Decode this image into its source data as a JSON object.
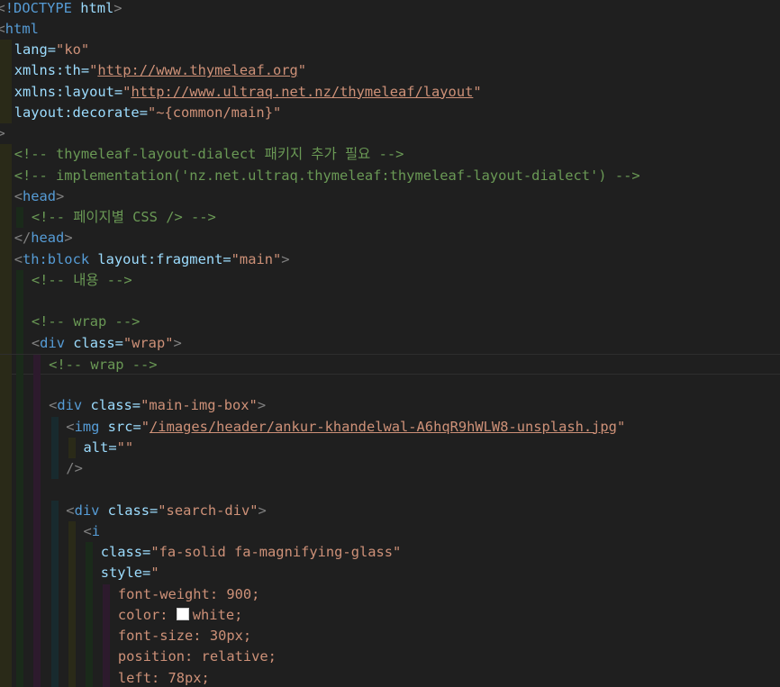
{
  "editor": {
    "language": "html",
    "active_line": 17,
    "lines": [
      {
        "indent": 0,
        "tokens": [
          [
            "b",
            "<"
          ],
          [
            "t",
            "!DOCTYPE"
          ],
          [
            "a",
            " html"
          ],
          [
            "b",
            ">"
          ]
        ]
      },
      {
        "indent": 0,
        "tokens": [
          [
            "b",
            "<"
          ],
          [
            "t",
            "html"
          ]
        ]
      },
      {
        "indent": 1,
        "tokens": [
          [
            "a",
            "lang"
          ],
          [
            "a",
            "="
          ],
          [
            "s",
            "\"ko\""
          ]
        ]
      },
      {
        "indent": 1,
        "tokens": [
          [
            "a",
            "xmlns:th"
          ],
          [
            "a",
            "="
          ],
          [
            "s",
            "\""
          ],
          [
            "l",
            "http://www.thymeleaf.org"
          ],
          [
            "s",
            "\""
          ]
        ]
      },
      {
        "indent": 1,
        "tokens": [
          [
            "a",
            "xmlns:layout"
          ],
          [
            "a",
            "="
          ],
          [
            "s",
            "\""
          ],
          [
            "l",
            "http://www.ultraq.net.nz/thymeleaf/layout"
          ],
          [
            "s",
            "\""
          ]
        ]
      },
      {
        "indent": 1,
        "tokens": [
          [
            "a",
            "layout:decorate"
          ],
          [
            "a",
            "="
          ],
          [
            "s",
            "\"~{common/main}\""
          ]
        ]
      },
      {
        "indent": 0,
        "tokens": [
          [
            "b",
            ">"
          ]
        ]
      },
      {
        "indent": 1,
        "tokens": [
          [
            "c",
            "<!-- thymeleaf-layout-dialect 패키지 추가 필요 -->"
          ]
        ]
      },
      {
        "indent": 1,
        "tokens": [
          [
            "c",
            "<!-- implementation('nz.net.ultraq.thymeleaf:thymeleaf-layout-dialect') -->"
          ]
        ]
      },
      {
        "indent": 1,
        "tokens": [
          [
            "b",
            "<"
          ],
          [
            "t",
            "head"
          ],
          [
            "b",
            ">"
          ]
        ]
      },
      {
        "indent": 2,
        "tokens": [
          [
            "c",
            "<!-- 페이지별 CSS /> -->"
          ]
        ]
      },
      {
        "indent": 1,
        "tokens": [
          [
            "b",
            "</"
          ],
          [
            "t",
            "head"
          ],
          [
            "b",
            ">"
          ]
        ]
      },
      {
        "indent": 1,
        "tokens": [
          [
            "b",
            "<"
          ],
          [
            "t",
            "th:block"
          ],
          [
            "a",
            " layout:fragment"
          ],
          [
            "a",
            "="
          ],
          [
            "s",
            "\"main\""
          ],
          [
            "b",
            ">"
          ]
        ]
      },
      {
        "indent": 2,
        "tokens": [
          [
            "c",
            "<!-- 내용 -->"
          ]
        ]
      },
      {
        "indent": 2,
        "tokens": []
      },
      {
        "indent": 2,
        "tokens": [
          [
            "c",
            "<!-- wrap -->"
          ]
        ]
      },
      {
        "indent": 2,
        "tokens": [
          [
            "b",
            "<"
          ],
          [
            "t",
            "div"
          ],
          [
            "a",
            " class"
          ],
          [
            "a",
            "="
          ],
          [
            "s",
            "\"wrap\""
          ],
          [
            "b",
            ">"
          ]
        ]
      },
      {
        "indent": 3,
        "tokens": [
          [
            "c",
            "<!-- wrap -->"
          ]
        ]
      },
      {
        "indent": 3,
        "tokens": []
      },
      {
        "indent": 3,
        "tokens": [
          [
            "b",
            "<"
          ],
          [
            "t",
            "div"
          ],
          [
            "a",
            " class"
          ],
          [
            "a",
            "="
          ],
          [
            "s",
            "\"main-img-box\""
          ],
          [
            "b",
            ">"
          ]
        ]
      },
      {
        "indent": 4,
        "tokens": [
          [
            "b",
            "<"
          ],
          [
            "t",
            "img"
          ],
          [
            "a",
            " src"
          ],
          [
            "a",
            "="
          ],
          [
            "s",
            "\""
          ],
          [
            "l",
            "/images/header/ankur-khandelwal-A6hqR9hWLW8-unsplash.jpg"
          ],
          [
            "s",
            "\""
          ]
        ]
      },
      {
        "indent": 5,
        "tokens": [
          [
            "a",
            "alt"
          ],
          [
            "a",
            "="
          ],
          [
            "s",
            "\"\""
          ]
        ]
      },
      {
        "indent": 4,
        "tokens": [
          [
            "b",
            "/>"
          ]
        ]
      },
      {
        "indent": 3,
        "tokens": []
      },
      {
        "indent": 4,
        "tokens": [
          [
            "b",
            "<"
          ],
          [
            "t",
            "div"
          ],
          [
            "a",
            " class"
          ],
          [
            "a",
            "="
          ],
          [
            "s",
            "\"search-div\""
          ],
          [
            "b",
            ">"
          ]
        ]
      },
      {
        "indent": 5,
        "tokens": [
          [
            "b",
            "<"
          ],
          [
            "t",
            "i"
          ]
        ]
      },
      {
        "indent": 6,
        "tokens": [
          [
            "a",
            "class"
          ],
          [
            "a",
            "="
          ],
          [
            "s",
            "\"fa-solid fa-magnifying-glass\""
          ]
        ]
      },
      {
        "indent": 6,
        "tokens": [
          [
            "a",
            "style"
          ],
          [
            "a",
            "="
          ],
          [
            "s",
            "\""
          ]
        ]
      },
      {
        "indent": 7,
        "tokens": [
          [
            "s",
            "font-weight: 900;"
          ]
        ]
      },
      {
        "indent": 7,
        "tokens": [
          [
            "s",
            "color: "
          ],
          [
            "swatch",
            "#ffffff"
          ],
          [
            "s",
            "white;"
          ]
        ]
      },
      {
        "indent": 7,
        "tokens": [
          [
            "s",
            "font-size: 30px;"
          ]
        ]
      },
      {
        "indent": 7,
        "tokens": [
          [
            "s",
            "position: relative;"
          ]
        ]
      },
      {
        "indent": 7,
        "tokens": [
          [
            "s",
            "left: 78px;"
          ]
        ]
      }
    ]
  }
}
